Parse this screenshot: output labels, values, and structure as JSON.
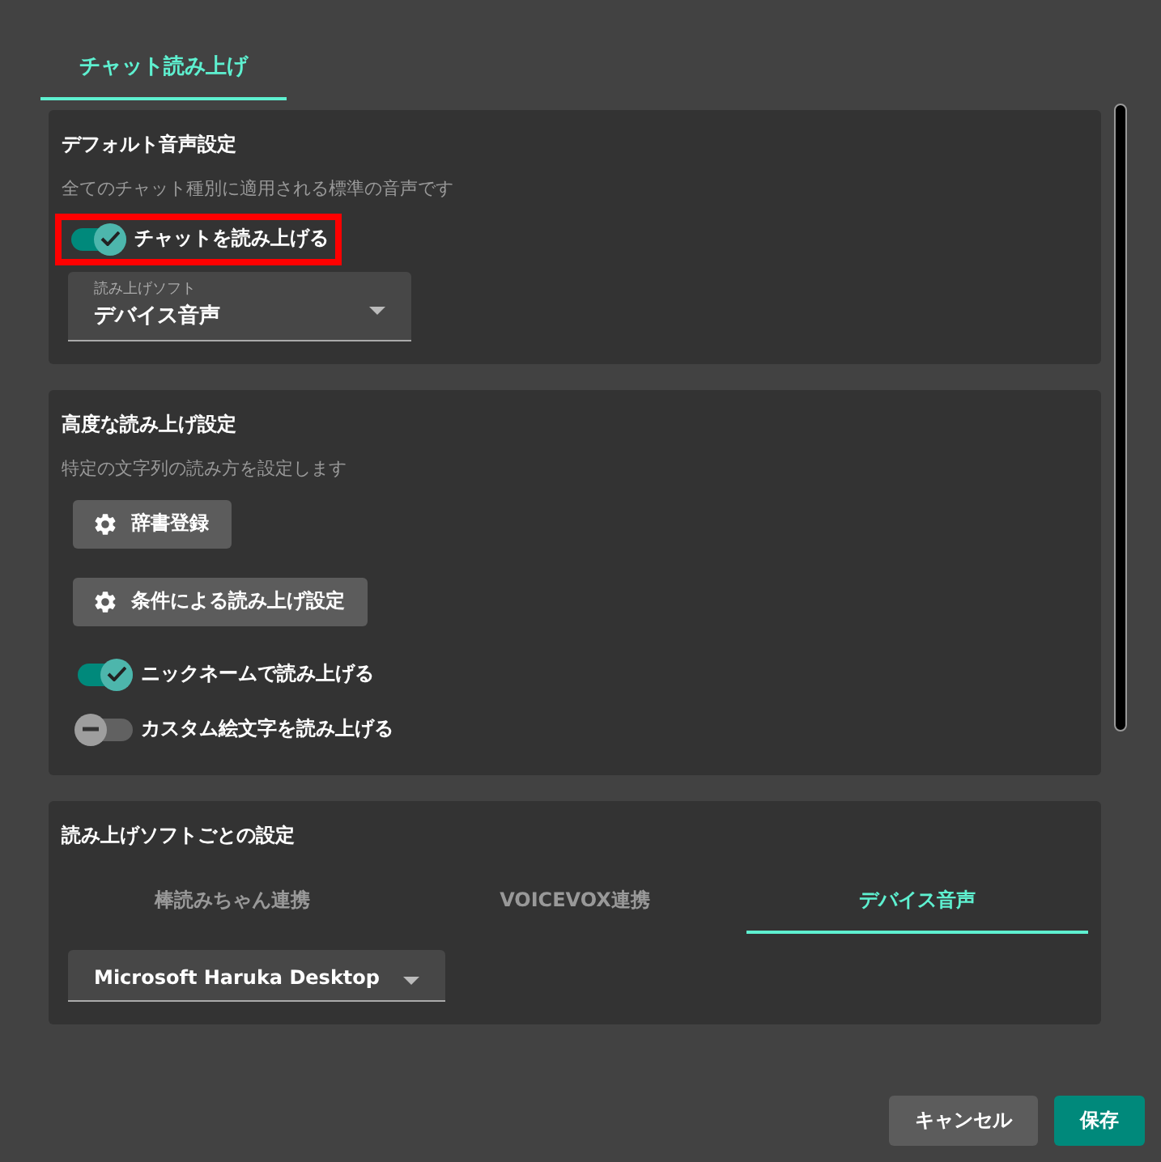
{
  "tabs": [
    {
      "label": "チャット読み上げ",
      "selected": true
    }
  ],
  "sections": [
    {
      "title": "デフォルト音声設定",
      "description": "全てのチャット種別に適用される標準の音声です",
      "items": [
        {
          "kind": "toggle",
          "label": "チャットを読み上げる",
          "on": true,
          "highlighted": true
        },
        {
          "kind": "select",
          "label": "読み上げソフト",
          "value": "デバイス音声"
        }
      ]
    },
    {
      "title": "高度な読み上げ設定",
      "description": "特定の文字列の読み方を設定します",
      "items": [
        {
          "kind": "button",
          "label": "辞書登録"
        },
        {
          "kind": "button",
          "label": "条件による読み上げ設定"
        },
        {
          "kind": "toggle",
          "label": "ニックネームで読み上げる",
          "on": true,
          "highlighted": false
        },
        {
          "kind": "toggle",
          "label": "カスタム絵文字を読み上げる",
          "on": false,
          "highlighted": false
        }
      ]
    },
    {
      "title": "読み上げソフトごとの設定",
      "items": [
        {
          "kind": "tabs",
          "tabs": [
            {
              "label": "棒読みちゃん連携",
              "selected": false
            },
            {
              "label": "VOICEVOX連携",
              "selected": false
            },
            {
              "label": "デバイス音声",
              "selected": true
            }
          ]
        },
        {
          "kind": "select",
          "value": "Microsoft Haruka Desktop"
        }
      ]
    }
  ],
  "buttons": [
    {
      "label": "キャンセル",
      "kind": "secondary"
    },
    {
      "label": "保存",
      "kind": "primary"
    }
  ]
}
